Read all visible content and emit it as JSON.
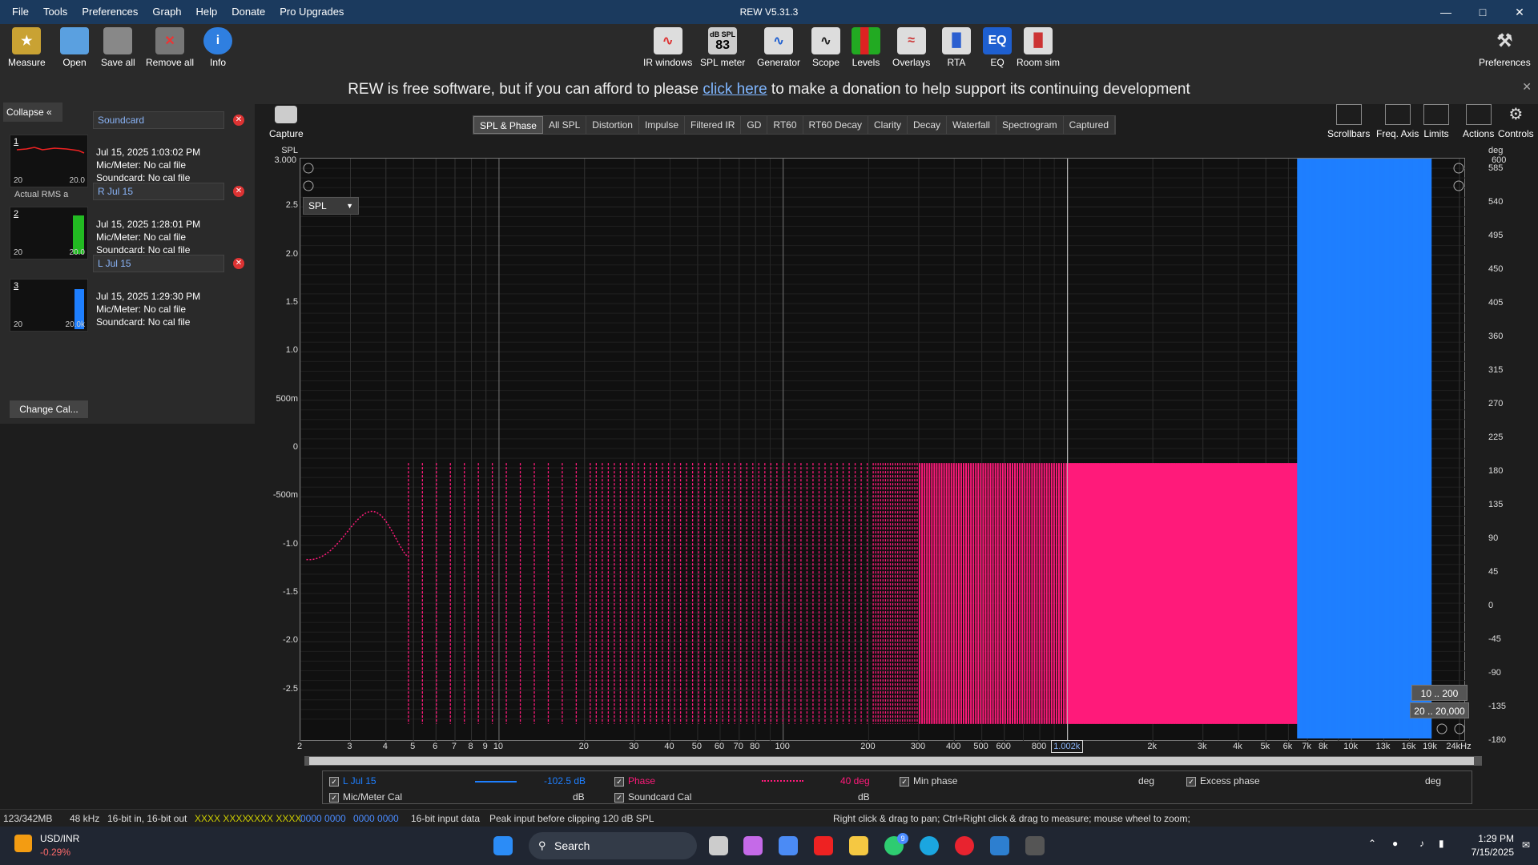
{
  "window": {
    "title": "REW V5.31.3"
  },
  "menu": [
    "File",
    "Tools",
    "Preferences",
    "Graph",
    "Help",
    "Donate",
    "Pro Upgrades"
  ],
  "toolbar": {
    "left": [
      {
        "label": "Measure"
      },
      {
        "label": "Open"
      },
      {
        "label": "Save all"
      },
      {
        "label": "Remove all"
      },
      {
        "label": "Info"
      }
    ],
    "center": [
      {
        "label": "IR windows"
      },
      {
        "label": "SPL meter",
        "badge": "dB SPL",
        "value": "83"
      },
      {
        "label": "Generator"
      },
      {
        "label": "Scope"
      },
      {
        "label": "Levels"
      },
      {
        "label": "Overlays"
      },
      {
        "label": "RTA"
      },
      {
        "label": "EQ"
      },
      {
        "label": "Room sim"
      }
    ],
    "right": {
      "label": "Preferences"
    }
  },
  "banner": {
    "before": "REW is free software, but if you can afford to please ",
    "link": "click here",
    "after": " to make a donation to help support its continuing development"
  },
  "sidebar": {
    "collapse": "Collapse",
    "soundcard_name": "Soundcard",
    "measurements": [
      {
        "num": "1",
        "name": "Soundcard",
        "date": "Jul 15, 2025 1:03:02 PM",
        "mic": "Mic/Meter: No cal file",
        "sound": "Soundcard: No cal file",
        "axis_min": "20",
        "axis_max": "20.0",
        "extra": "Actual RMS a"
      },
      {
        "num": "2",
        "name": "R Jul 15",
        "date": "Jul 15, 2025 1:28:01 PM",
        "mic": "Mic/Meter: No cal file",
        "sound": "Soundcard: No cal file",
        "axis_min": "20",
        "axis_max": "20.0"
      },
      {
        "num": "3",
        "name": "L Jul 15",
        "date": "Jul 15, 2025 1:29:30 PM",
        "mic": "Mic/Meter: No cal file",
        "sound": "Soundcard: No cal file",
        "axis_min": "20",
        "axis_max": "20.0k"
      }
    ],
    "change_cal": "Change Cal..."
  },
  "capture_label": "Capture",
  "tabs": [
    {
      "label": "SPL & Phase",
      "active": true
    },
    {
      "label": "All SPL"
    },
    {
      "label": "Distortion"
    },
    {
      "label": "Impulse"
    },
    {
      "label": "Filtered IR"
    },
    {
      "label": "GD"
    },
    {
      "label": "RT60"
    },
    {
      "label": "RT60 Decay"
    },
    {
      "label": "Clarity"
    },
    {
      "label": "Decay"
    },
    {
      "label": "Waterfall"
    },
    {
      "label": "Spectrogram"
    },
    {
      "label": "Captured"
    }
  ],
  "right_tools": [
    "Scrollbars",
    "Freq. Axis",
    "Limits",
    "Actions",
    "Controls"
  ],
  "graph": {
    "left_unit": "SPL",
    "left_top": "3.000",
    "left_ticks": [
      "2.5",
      "2.0",
      "1.5",
      "1.0",
      "500m",
      "0",
      "-500m",
      "-1.0",
      "-1.5",
      "-2.0",
      "-2.5"
    ],
    "right_unit": "deg",
    "right_top": "600",
    "right_ticks": [
      "585",
      "540",
      "495",
      "450",
      "405",
      "360",
      "315",
      "270",
      "225",
      "180",
      "135",
      "90",
      "45",
      "0",
      "-45",
      "-90",
      "-135",
      "-180"
    ],
    "x_ticks": [
      "2",
      "3",
      "4",
      "5",
      "6",
      "7",
      "8",
      "9",
      "10",
      "20",
      "30",
      "40",
      "50",
      "60",
      "70",
      "80",
      "100",
      "200",
      "300",
      "400",
      "500",
      "600",
      "800",
      "2k",
      "3k",
      "4k",
      "5k",
      "6k",
      "7k",
      "8k",
      "10k",
      "13k",
      "16k",
      "19k",
      "24kHz"
    ],
    "cursor_freq": "1.002k",
    "spl_select": "SPL",
    "zoom_ranges": [
      "10 .. 200",
      "20 .. 20,000"
    ],
    "colors": {
      "spl": "#1e7fff",
      "phase": "#ff1a7a"
    }
  },
  "legend": {
    "row1": [
      {
        "label": "L Jul 15",
        "value": "-102.5 dB",
        "color": "#1e7fff"
      },
      {
        "label": "Phase",
        "value": "40 deg",
        "color": "#ff1a7a"
      },
      {
        "label": "Min phase",
        "unit": "deg"
      },
      {
        "label": "Excess phase",
        "unit": "deg"
      }
    ],
    "row2": [
      {
        "label": "Mic/Meter Cal",
        "unit": "dB"
      },
      {
        "label": "Soundcard Cal",
        "unit": "dB"
      }
    ]
  },
  "status": {
    "memory": "123/342MB",
    "rate": "48 kHz",
    "bits": "16-bit in, 16-bit out",
    "meter1": "XXXX XXXX",
    "meter2": "XXXX XXXX",
    "meter3": "0000 0000",
    "meter4": "0000 0000",
    "input": "16-bit input data",
    "peak": "Peak input before clipping 120 dB SPL",
    "hint": "Right click & drag to pan; Ctrl+Right click & drag to measure; mouse wheel to zoom;"
  },
  "taskbar": {
    "ticker": "USD/INR",
    "change": "-0.29%",
    "search": "Search",
    "time": "1:29 PM",
    "date": "7/15/2025",
    "badge": "9"
  }
}
